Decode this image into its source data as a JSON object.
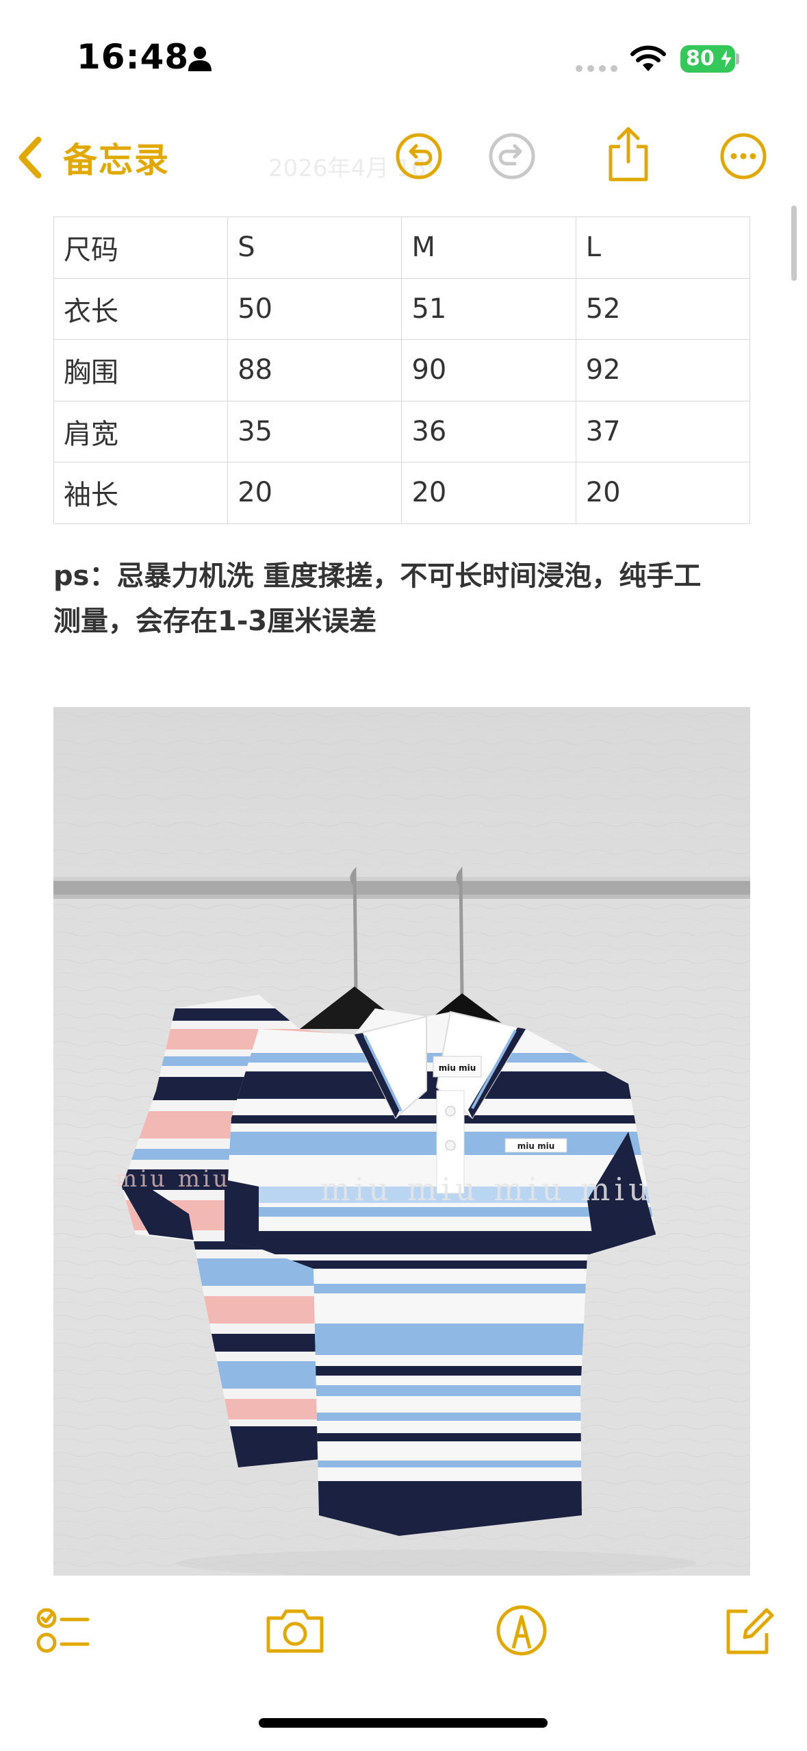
{
  "status_bar": {
    "time": "16:48",
    "battery": "80"
  },
  "nav": {
    "back_label": "备忘录",
    "date_faded": "2026年4月        16:"
  },
  "table": {
    "rows": [
      [
        "尺码",
        "S",
        "M",
        "L"
      ],
      [
        "衣长",
        "50",
        "51",
        "52"
      ],
      [
        "胸围",
        "88",
        "90",
        "92"
      ],
      [
        "肩宽",
        "35",
        "36",
        "37"
      ],
      [
        "袖长",
        "20",
        "20",
        "20"
      ]
    ]
  },
  "note": {
    "line1": "ps：忌暴力机洗 重度揉搓，不可长时间浸泡，纯手工",
    "line2": "测量，会存在1-3厘米误差"
  },
  "photo": {
    "label_text": "miu miu",
    "knit_text": "miu miu"
  },
  "colors": {
    "accent": "#e0a800",
    "navy": "#1b2140",
    "light_blue": "#8fb9e4",
    "pink": "#f2b9b4"
  },
  "icons": {
    "back": "chevron-left-icon",
    "undo": "undo-icon",
    "redo": "redo-icon",
    "share": "share-icon",
    "more": "more-icon",
    "checklist": "checklist-icon",
    "camera": "camera-icon",
    "markup": "markup-icon",
    "compose": "compose-icon"
  }
}
